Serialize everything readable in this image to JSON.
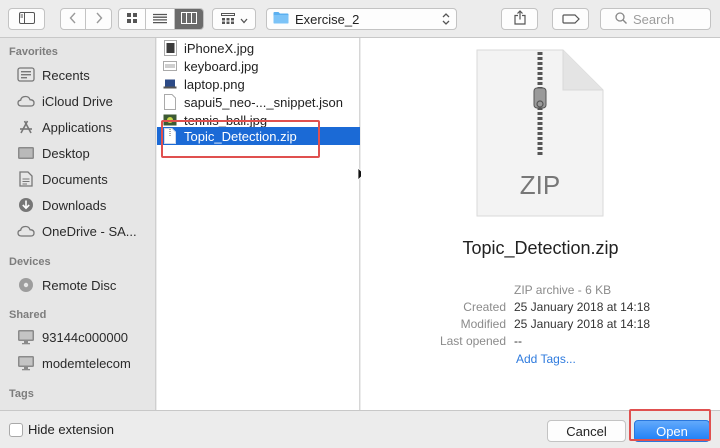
{
  "toolbar": {
    "path_label": "Exercise_2",
    "search_placeholder": "Search"
  },
  "sidebar": {
    "sections": {
      "favorites": "Favorites",
      "devices": "Devices",
      "shared": "Shared",
      "tags": "Tags"
    },
    "favorites": [
      {
        "label": "Recents",
        "icon": "recents-icon"
      },
      {
        "label": "iCloud Drive",
        "icon": "cloud-icon"
      },
      {
        "label": "Applications",
        "icon": "applications-icon"
      },
      {
        "label": "Desktop",
        "icon": "desktop-icon"
      },
      {
        "label": "Documents",
        "icon": "documents-icon"
      },
      {
        "label": "Downloads",
        "icon": "downloads-icon"
      },
      {
        "label": "OneDrive - SA...",
        "icon": "cloud-icon"
      }
    ],
    "devices": [
      {
        "label": "Remote Disc",
        "icon": "disc-icon"
      }
    ],
    "shared": [
      {
        "label": "93144c000000",
        "icon": "computer-icon"
      },
      {
        "label": "modemtelecom",
        "icon": "computer-icon"
      }
    ]
  },
  "files": [
    {
      "name": "iPhoneX.jpg",
      "icon": "image-file-icon"
    },
    {
      "name": "keyboard.jpg",
      "icon": "image-file-icon"
    },
    {
      "name": "laptop.png",
      "icon": "image-file-icon"
    },
    {
      "name": "sapui5_neo-..._snippet.json",
      "icon": "document-file-icon"
    },
    {
      "name": "tennis_ball.jpg",
      "icon": "image-file-icon"
    },
    {
      "name": "Topic_Detection.zip",
      "icon": "zip-file-icon",
      "selected": true
    }
  ],
  "preview": {
    "icon_text": "ZIP",
    "filename": "Topic_Detection.zip",
    "kind": "ZIP archive - 6 KB",
    "created_label": "Created",
    "created": "25 January 2018 at 14:18",
    "modified_label": "Modified",
    "modified": "25 January 2018 at 14:18",
    "last_opened_label": "Last opened",
    "last_opened": "--",
    "add_tags": "Add Tags..."
  },
  "bottom": {
    "hide_extension": "Hide extension",
    "cancel": "Cancel",
    "open": "Open"
  },
  "colors": {
    "selection": "#1b6ad6",
    "annotation": "#e0504f",
    "open_button": "#1c7ef7",
    "link": "#2f7bde"
  }
}
